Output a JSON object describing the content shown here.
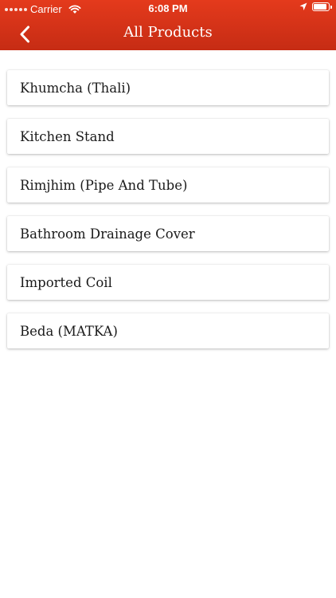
{
  "status_bar": {
    "carrier": "Carrier",
    "time": "6:08 PM",
    "battery_level": 0.95
  },
  "nav": {
    "title": "All Products",
    "back_icon": "chevron-left-icon"
  },
  "products": [
    {
      "label": "Khumcha (Thali)"
    },
    {
      "label": "Kitchen Stand"
    },
    {
      "label": "Rimjhim (Pipe And Tube)"
    },
    {
      "label": "Bathroom Drainage Cover"
    },
    {
      "label": "Imported Coil"
    },
    {
      "label": "Beda (MATKA)"
    }
  ],
  "colors": {
    "header_top": "#e43a1c",
    "header_bottom": "#c62c14",
    "text": "#1a1a1a",
    "background": "#ffffff"
  }
}
